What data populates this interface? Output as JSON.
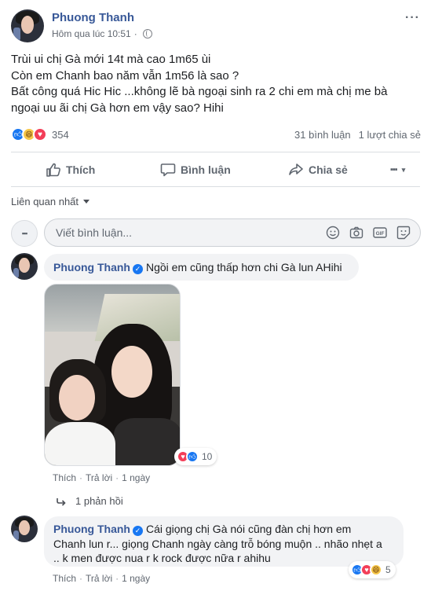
{
  "post": {
    "author": "Phuong Thanh",
    "timestamp": "Hôm qua lúc 10:51",
    "more_icon": "more-horizontal-icon",
    "privacy_icon": "globe-icon",
    "lines": [
      "Trùi ui chị Gà mới 14t mà cao 1m65 ùi",
      "Còn em Chanh bao năm vẫn 1m56 là sao ?",
      "Bất công quá Hic Hic ...không lẽ bà ngoại sinh ra 2 chi em mà chị me bà",
      "ngoại uu ãi chị Gà hơn em vậy sao? Hihi"
    ],
    "reactions": [
      "like",
      "haha",
      "love"
    ],
    "reaction_count": "354",
    "comments_count": "31 bình luận",
    "shares_count": "1 lượt chia sẻ"
  },
  "actions": {
    "like": "Thích",
    "comment": "Bình luận",
    "share": "Chia sẻ"
  },
  "filter": {
    "label": "Liên quan nhất"
  },
  "composer": {
    "placeholder": "Viết bình luận...",
    "icons": [
      "emoji-icon",
      "camera-icon",
      "gif-icon",
      "sticker-icon"
    ]
  },
  "comments": [
    {
      "author": "Phuong Thanh",
      "text": "Ngồi em cũng thấp hơn chi Gà lun AHihi",
      "reactions": [
        "love",
        "like"
      ],
      "reaction_count": "10",
      "like": "Thích",
      "reply": "Trả lời",
      "time": "1 ngày",
      "replies_link": "1 phản hồi"
    },
    {
      "author": "Phuong Thanh",
      "text_lines": [
        "Cái giọng chị Gà nói cũng đàn chị hơn em",
        "Chanh lun r... giọng Chanh ngày càng trỗ bóng muộn .. nhão nhẹt a",
        ".. k men được nua r k rock được nữa r ahihu"
      ],
      "reactions": [
        "like",
        "love",
        "haha"
      ],
      "reaction_count": "5",
      "like": "Thích",
      "reply": "Trả lời",
      "time": "1 ngày"
    }
  ],
  "colors": {
    "link": "#385898",
    "like_blue": "#1877f2",
    "love_red": "#f33e58",
    "haha_yellow": "#f7c748",
    "bubble_bg": "#f2f3f5",
    "secondary_text": "#606770"
  }
}
